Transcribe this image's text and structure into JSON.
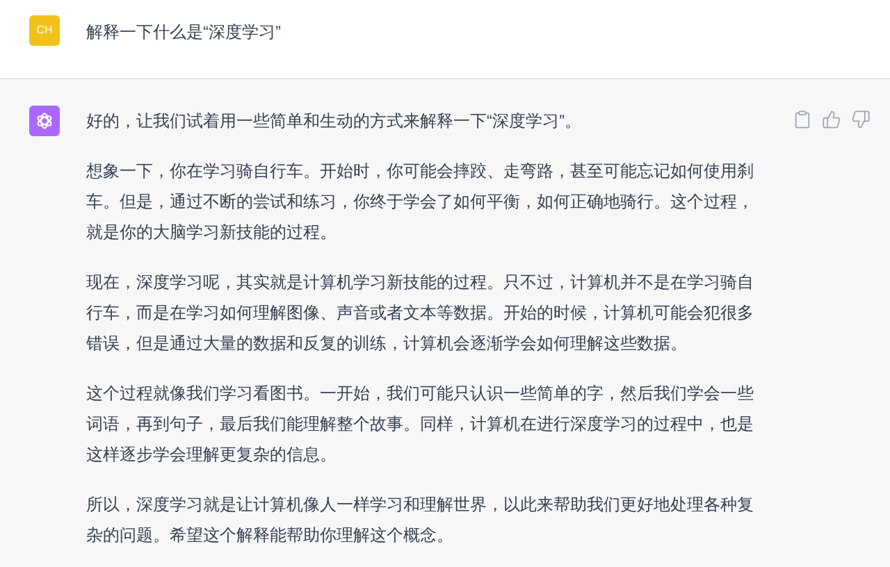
{
  "messages": [
    {
      "kind": "user",
      "avatar": "CH",
      "paragraphs": [
        "解释一下什么是“深度学习”"
      ]
    },
    {
      "kind": "assistant",
      "paragraphs": [
        "好的，让我们试着用一些简单和生动的方式来解释一下“深度学习”。",
        "想象一下，你在学习骑自行车。开始时，你可能会摔跤、走弯路，甚至可能忘记如何使用刹车。但是，通过不断的尝试和练习，你终于学会了如何平衡，如何正确地骑行。这个过程，就是你的大脑学习新技能的过程。",
        "现在，深度学习呢，其实就是计算机学习新技能的过程。只不过，计算机并不是在学习骑自行车，而是在学习如何理解图像、声音或者文本等数据。开始的时候，计算机可能会犯很多错误，但是通过大量的数据和反复的训练，计算机会逐渐学会如何理解这些数据。",
        "这个过程就像我们学习看图书。一开始，我们可能只认识一些简单的字，然后我们学会一些词语，再到句子，最后我们能理解整个故事。同样，计算机在进行深度学习的过程中，也是这样逐步学会理解更复杂的信息。",
        "所以，深度学习就是让计算机像人一样学习和理解世界，以此来帮助我们更好地处理各种复杂的问题。希望这个解释能帮助你理解这个概念。"
      ]
    }
  ]
}
